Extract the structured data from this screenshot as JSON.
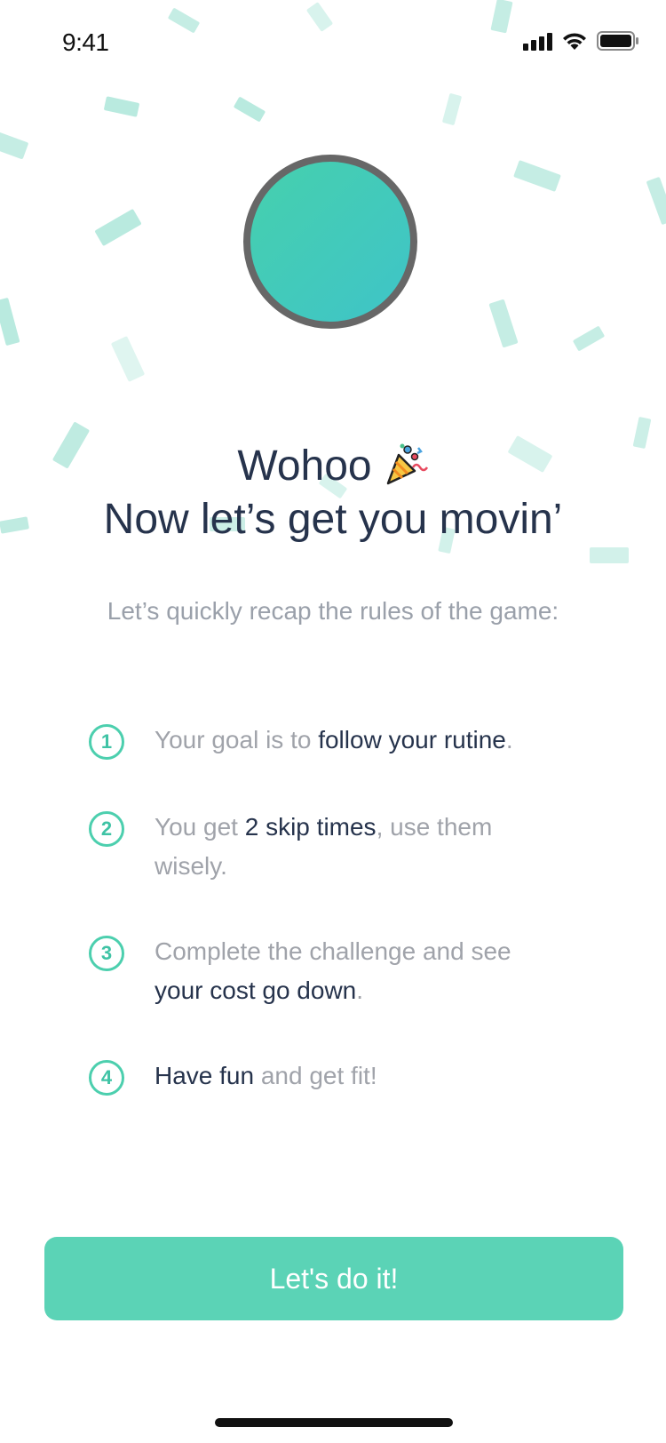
{
  "status_bar": {
    "time": "9:41"
  },
  "title_line_1": "Wohoo",
  "title_line_2": "Now let’s get you movin’",
  "subtitle": "Let’s quickly recap the rules of the game:",
  "rules": [
    {
      "number": "1",
      "text_a": "Your goal is to ",
      "highlight": "follow your rutine",
      "text_b": "."
    },
    {
      "number": "2",
      "text_a": "You get ",
      "highlight": "2 skip times",
      "text_b": ", use them wisely."
    },
    {
      "number": "3",
      "text_a": "Complete the challenge and see ",
      "highlight": "your cost go down",
      "text_b": "."
    },
    {
      "number": "4",
      "text_a": "",
      "highlight": "Have fun",
      "text_b": " and get fit!"
    }
  ],
  "cta_label": "Let's do it!",
  "colors": {
    "accent": "#5bd3b6",
    "title": "#26334c",
    "muted": "#9aa0aa",
    "avatar_border": "#676767"
  },
  "icons": {
    "title_icon": "party-popper-icon"
  }
}
